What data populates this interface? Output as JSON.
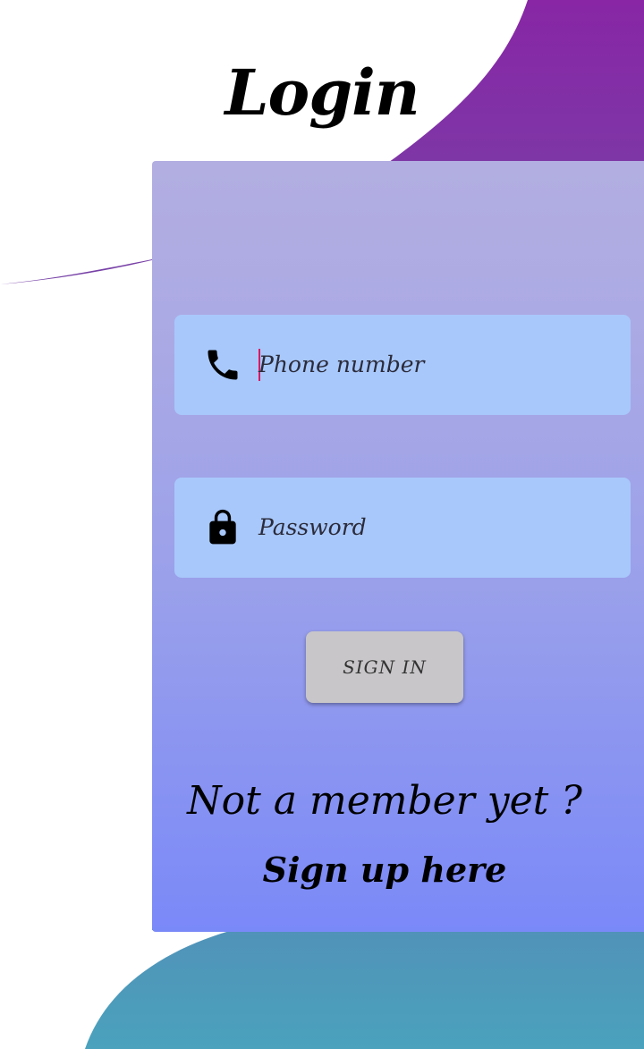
{
  "colors": {
    "purple": "#8826a5",
    "teal": "#4a9cbd",
    "card_top": "#b2aee1",
    "card_bottom": "#7a89f8",
    "field": "#a8c8fb",
    "button": "#c8c6c8",
    "caret": "#d81b60"
  },
  "login": {
    "title": "Login",
    "phone": {
      "placeholder": "Phone number",
      "icon": "phone-icon"
    },
    "password": {
      "placeholder": "Password",
      "icon": "lock-icon"
    },
    "sign_in_label": "SIGN IN",
    "not_member_text": "Not a member yet ?",
    "sign_up_link": "Sign up here"
  }
}
